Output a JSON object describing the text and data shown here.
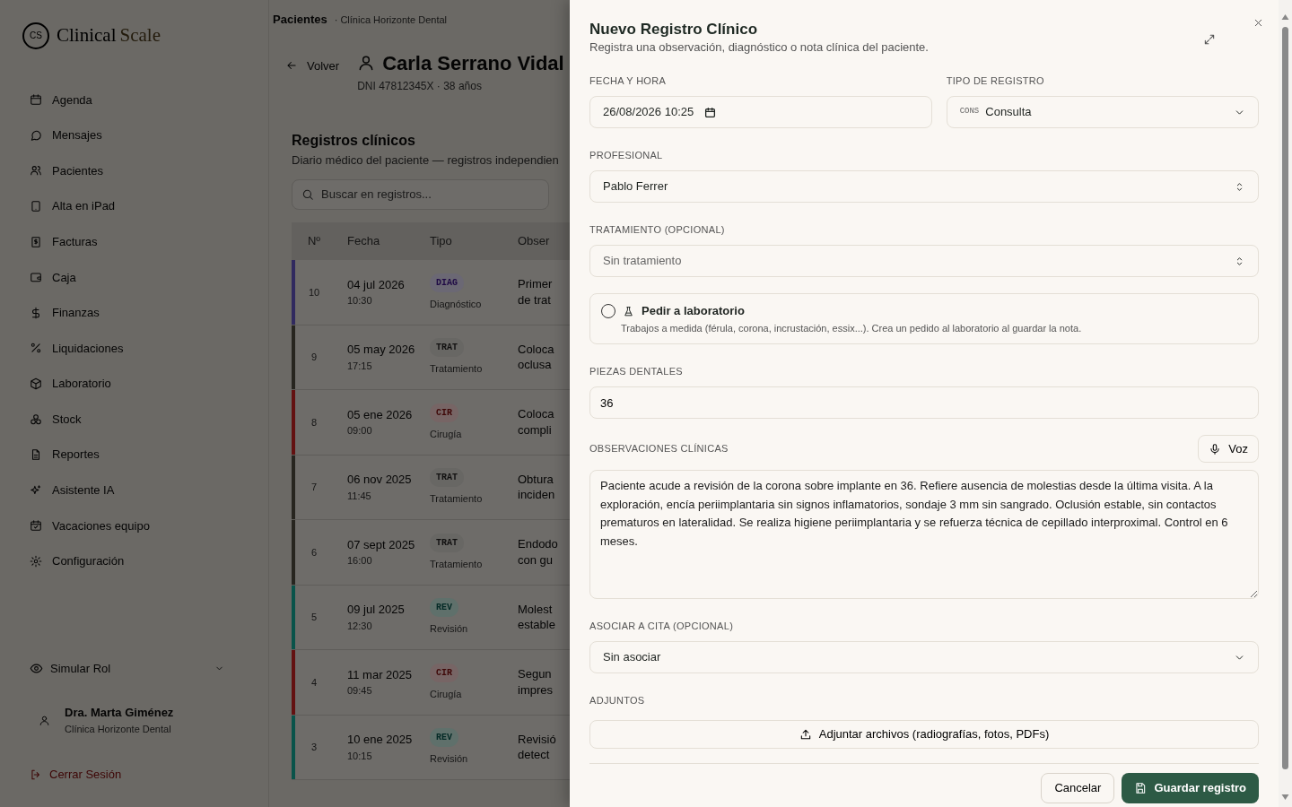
{
  "sidebar": {
    "logo": {
      "mark": "CS",
      "name": "Clinical",
      "accent": "Scale"
    },
    "nav_items": [
      {
        "label": "Agenda"
      },
      {
        "label": "Mensajes"
      },
      {
        "label": "Pacientes"
      },
      {
        "label": "Alta en iPad"
      },
      {
        "label": "Facturas"
      },
      {
        "label": "Caja"
      },
      {
        "label": "Finanzas"
      },
      {
        "label": "Liquidaciones"
      },
      {
        "label": "Laboratorio"
      },
      {
        "label": "Stock"
      },
      {
        "label": "Reportes"
      },
      {
        "label": "Asistente IA"
      },
      {
        "label": "Vacaciones equipo"
      },
      {
        "label": "Configuración"
      }
    ],
    "role_switcher": {
      "label": "Simular Rol"
    },
    "user": {
      "name": "Dra. Marta Giménez",
      "clinic": "Clínica Horizonte Dental"
    },
    "logout": "Cerrar Sesión"
  },
  "main": {
    "breadcrumb": {
      "section": "Pacientes",
      "clinic": "· Clínica Horizonte Dental"
    },
    "back_button": "Volver",
    "patient": {
      "name": "Carla Serrano Vidal",
      "details": "DNI 47812345X · 38 años"
    },
    "records": {
      "title": "Registros clínicos",
      "subtitle": "Diario médico del paciente — registros independien",
      "search_placeholder": "Buscar en registros...",
      "columns": [
        "Nº",
        "Fecha",
        "Tipo",
        "Obser"
      ],
      "rows": [
        {
          "number": "10",
          "date": "04 jul 2026",
          "time": "10:30",
          "kind": "diag",
          "code": "DIAG",
          "type": "Diagnóstico",
          "observation": [
            "Primer",
            "de trat"
          ],
          "color": "#312a5f"
        },
        {
          "number": "9",
          "date": "05 may 2026",
          "time": "17:15",
          "kind": "trat",
          "code": "TRAT",
          "type": "Tratamiento",
          "observation": [
            "Coloca",
            "oclusa"
          ],
          "color": "#27251f"
        },
        {
          "number": "8",
          "date": "05 ene 2026",
          "time": "09:00",
          "kind": "cir",
          "code": "CIR",
          "type": "Cirugía",
          "observation": [
            "Coloca",
            "compli"
          ],
          "color": "#631111"
        },
        {
          "number": "7",
          "date": "06 nov 2025",
          "time": "11:45",
          "kind": "trat",
          "code": "TRAT",
          "type": "Tratamiento",
          "observation": [
            "Obtura",
            "inciden"
          ],
          "color": "#27251f"
        },
        {
          "number": "6",
          "date": "07 sept 2025",
          "time": "16:00",
          "kind": "trat",
          "code": "TRAT",
          "type": "Tratamiento",
          "observation": [
            "Endodo",
            "con gu"
          ],
          "color": "#27251f"
        },
        {
          "number": "5",
          "date": "09 jul 2025",
          "time": "12:30",
          "kind": "rev",
          "code": "REV",
          "type": "Revisión",
          "observation": [
            "Molest",
            "estable"
          ],
          "color": "#09534a"
        },
        {
          "number": "4",
          "date": "11 mar 2025",
          "time": "09:45",
          "kind": "cir",
          "code": "CIR",
          "type": "Cirugía",
          "observation": [
            "Segun",
            "impres"
          ],
          "color": "#631111"
        },
        {
          "number": "3",
          "date": "10 ene 2025",
          "time": "10:15",
          "kind": "rev",
          "code": "REV",
          "type": "Revisión",
          "observation": [
            "Revisió",
            "detect"
          ],
          "color": "#09534a"
        }
      ]
    }
  },
  "dialog": {
    "title": "Nuevo Registro Clínico",
    "subtitle": "Registra una observación, diagnóstico o nota clínica del paciente.",
    "date_time": {
      "label": "FECHA Y HORA",
      "value": "26/08/2026 10:25"
    },
    "record_type": {
      "label": "TIPO DE REGISTRO",
      "code": "CONS",
      "value": "Consulta"
    },
    "professional": {
      "label": "PROFESIONAL",
      "value": "Pablo Ferrer"
    },
    "treatment": {
      "label": "TRATAMIENTO (OPCIONAL)",
      "placeholder": "Sin tratamiento"
    },
    "lab_request": {
      "label": "Pedir a laboratorio",
      "description": "Trabajos a medida (férula, corona, incrustación, essix...). Crea un pedido al laboratorio al guardar la nota.",
      "checked": false
    },
    "teeth": {
      "label": "PIEZAS DENTALES",
      "value": "36"
    },
    "observations": {
      "label": "OBSERVACIONES CLÍNICAS",
      "voice_button": "Voz",
      "value": "Paciente acude a revisión de la corona sobre implante en 36. Refiere ausencia de molestias desde la última visita. A la exploración, encía periimplantaria sin signos inflamatorios, sondaje 3 mm sin sangrado. Oclusión estable, sin contactos prematuros en lateralidad. Se realiza higiene periimplantaria y se refuerza técnica de cepillado interproximal. Control en 6 meses."
    },
    "appointment": {
      "label": "ASOCIAR A CITA (OPCIONAL)",
      "value": "Sin asociar"
    },
    "attachments": {
      "label": "ADJUNTOS",
      "button": "Adjuntar archivos (radiografías, fotos, PDFs)"
    },
    "buttons": {
      "cancel": "Cancelar",
      "save": "Guardar registro"
    }
  }
}
